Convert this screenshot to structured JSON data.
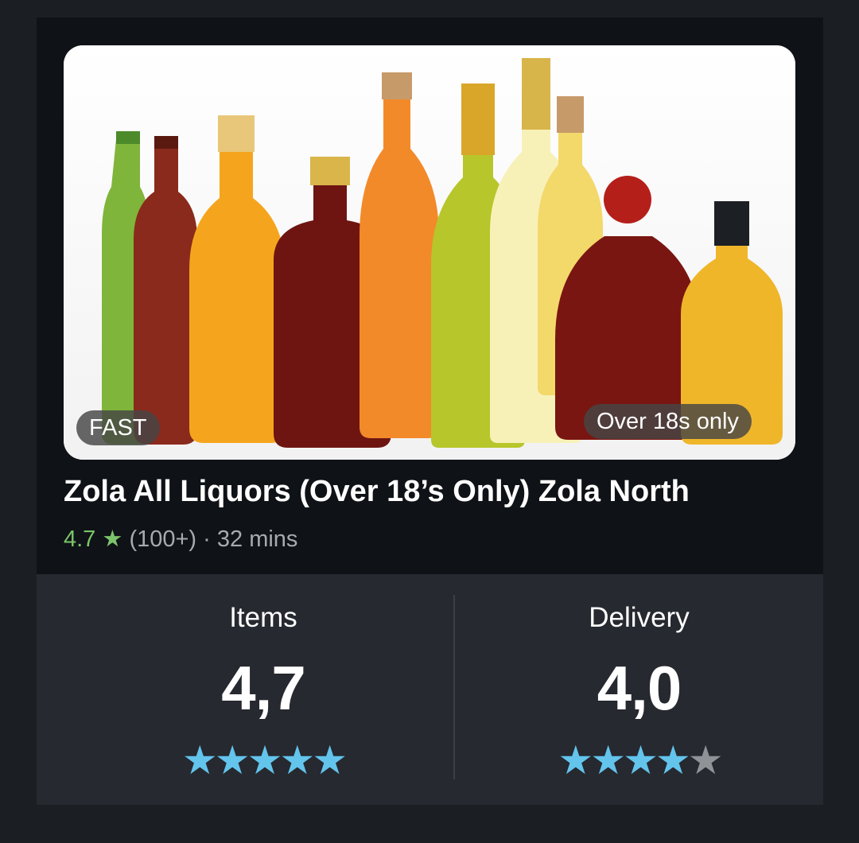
{
  "store": {
    "name": "Zola All Liquors (Over 18’s Only) Zola North",
    "rating": "4.7",
    "reviews": "(100+)",
    "separator": "·",
    "eta": "32 mins"
  },
  "hero": {
    "badge_fast": "FAST",
    "badge_age": "Over 18s only"
  },
  "ratings": {
    "items": {
      "label": "Items",
      "value": "4,7",
      "stars_filled": 5,
      "stars_total": 5
    },
    "delivery": {
      "label": "Delivery",
      "value": "4,0",
      "stars_filled": 4,
      "stars_total": 5
    }
  },
  "colors": {
    "accent_star": "#63c4ec",
    "rating_green": "#7bc46b",
    "star_empty": "#8f9296"
  },
  "icons": {
    "rating_star": "star-icon"
  }
}
